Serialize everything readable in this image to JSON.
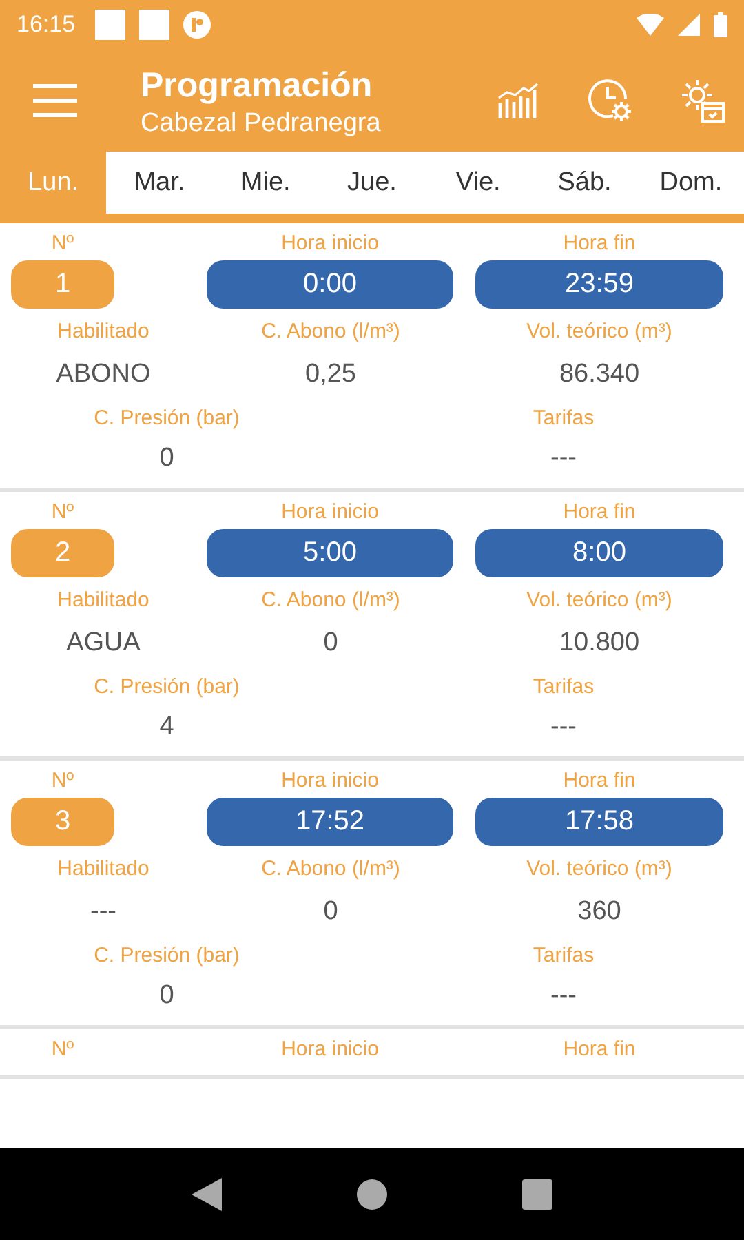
{
  "status_bar": {
    "time": "16:15"
  },
  "app_bar": {
    "title": "Programación",
    "subtitle": "Cabezal Pedranegra"
  },
  "tabs": [
    {
      "label": "Lun.",
      "selected": true
    },
    {
      "label": "Mar.",
      "selected": false
    },
    {
      "label": "Mie.",
      "selected": false
    },
    {
      "label": "Jue.",
      "selected": false
    },
    {
      "label": "Vie.",
      "selected": false
    },
    {
      "label": "Sáb.",
      "selected": false
    },
    {
      "label": "Dom.",
      "selected": false
    }
  ],
  "programs": [
    {
      "number_label": "Nº",
      "number": "1",
      "start_label": "Hora inicio",
      "start": "0:00",
      "end_label": "Hora fin",
      "end": "23:59",
      "enabled_label": "Habilitado",
      "enabled": "ABONO",
      "dose_label": "C. Abono (l/m³)",
      "dose": "0,25",
      "volume_label": "Vol. teórico (m³)",
      "volume": "86.340",
      "pressure_label": "C. Presión (bar)",
      "pressure": "0",
      "tariffs_label": "Tarifas",
      "tariffs": "---"
    },
    {
      "number_label": "Nº",
      "number": "2",
      "start_label": "Hora inicio",
      "start": "5:00",
      "end_label": "Hora fin",
      "end": "8:00",
      "enabled_label": "Habilitado",
      "enabled": "AGUA",
      "dose_label": "C. Abono (l/m³)",
      "dose": "0",
      "volume_label": "Vol. teórico (m³)",
      "volume": "10.800",
      "pressure_label": "C. Presión (bar)",
      "pressure": "4",
      "tariffs_label": "Tarifas",
      "tariffs": "---"
    },
    {
      "number_label": "Nº",
      "number": "3",
      "start_label": "Hora inicio",
      "start": "17:52",
      "end_label": "Hora fin",
      "end": "17:58",
      "enabled_label": "Habilitado",
      "enabled": "---",
      "dose_label": "C. Abono (l/m³)",
      "dose": "0",
      "volume_label": "Vol. teórico (m³)",
      "volume": "360",
      "pressure_label": "C. Presión (bar)",
      "pressure": "0",
      "tariffs_label": "Tarifas",
      "tariffs": "---"
    },
    {
      "number_label": "Nº",
      "start_label": "Hora inicio",
      "end_label": "Hora fin"
    }
  ]
}
